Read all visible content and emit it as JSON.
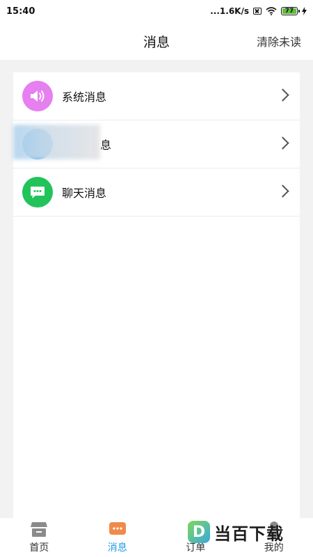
{
  "status_bar": {
    "time": "15:40",
    "network_speed": "...1.6K/s",
    "battery_level": "77"
  },
  "header": {
    "title": "消息",
    "action_label": "清除未读"
  },
  "messages": [
    {
      "label": "系统消息",
      "icon": "speaker-icon",
      "color": "#e67ff0"
    },
    {
      "label": "息",
      "icon": "blurred-icon",
      "color": "#4aa7ea"
    },
    {
      "label": "聊天消息",
      "icon": "chat-bubble-icon",
      "color": "#22c35a"
    }
  ],
  "tabs": [
    {
      "label": "首页",
      "icon": "store-icon",
      "active": false
    },
    {
      "label": "消息",
      "icon": "message-icon",
      "active": true
    },
    {
      "label": "订单",
      "icon": "calendar-icon",
      "active": false
    },
    {
      "label": "我的",
      "icon": "user-icon",
      "active": false
    }
  ],
  "watermark": {
    "badge": "D",
    "text": "当百下载"
  },
  "colors": {
    "accent": "#1e9be8",
    "background": "#f2f2f2"
  }
}
